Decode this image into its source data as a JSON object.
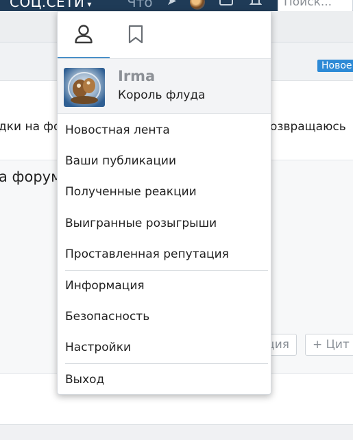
{
  "topnav": {
    "soc_label": "СОЦ.СЕТИ",
    "other_label": "Что",
    "search_placeholder": "Поиск..."
  },
  "background": {
    "badge_new": "Новое",
    "frag_left": "дки на фор",
    "frag_right": "озвращаюсь",
    "frag_forum": "а форум",
    "btn_reaction": "ция",
    "btn_quote": "Цит"
  },
  "dropdown": {
    "tabs": [
      {
        "icon": "user-icon",
        "active": true
      },
      {
        "icon": "bookmark-icon",
        "active": false
      }
    ],
    "profile": {
      "name": "Irma",
      "title": "Король флуда"
    },
    "menu": [
      {
        "label": "Новостная лента"
      },
      {
        "label": "Ваши публикации"
      },
      {
        "label": "Полученные реакции"
      },
      {
        "label": "Выигранные розыгрыши"
      },
      {
        "label": "Проставленная репутация"
      },
      {
        "label": "Информация"
      },
      {
        "label": "Безопасность"
      },
      {
        "label": "Настройки"
      },
      {
        "label": "Выход"
      }
    ]
  },
  "colors": {
    "topbar": "#1f3b57",
    "accent": "#4a90c8",
    "badge": "#2d8ad6"
  }
}
